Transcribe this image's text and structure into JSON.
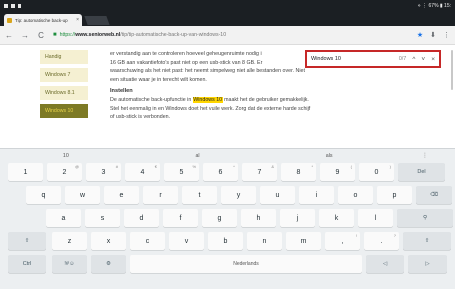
{
  "status": {
    "right_text": "⋄ ⋮ 67% ▮ 15:"
  },
  "tab": {
    "title": "Tip: automatische back-up",
    "close": "×"
  },
  "toolbar": {
    "back": "←",
    "forward": "→",
    "reload": "C",
    "https": "https://",
    "host": "www.seniorweb.nl",
    "path": "/tip/tip-automatische-back-up-van-windows-10",
    "star": "★",
    "download": "⬇",
    "menu": "⋮"
  },
  "findbar": {
    "query": "Windows 10",
    "count": "0/7",
    "up": "^",
    "down": "˅",
    "close": "×"
  },
  "sidebar": {
    "items": [
      {
        "label": "Handig"
      },
      {
        "label": "Windows 7"
      },
      {
        "label": "Windows 8.1"
      },
      {
        "label": "Windows 10"
      }
    ]
  },
  "content": {
    "p1a": "er verstandig aan te controleren hoeveel geheugenruimte nodig i",
    "p1b": "16 GB aan vakantiefoto's past niet op een usb-stick van 8 GB. Er",
    "p1c": "waarschuwing als het niet past: het neemt simpelweg niet alle bestanden over. Niet",
    "p1d": "een situatie waar je in terecht wilt komen.",
    "heading": "Instellen",
    "p2a_pre": "De automatische back-upfunctie in ",
    "p2a_mark": "Windows 10",
    "p2a_post": " maakt het de gebruiker gemakkelijk.",
    "p2b": "Stel het eenmalig in en Windows doet het vuile werk. Zorg dat de externe harde schijf",
    "p2c": "of usb-stick is verbonden."
  },
  "keyboard": {
    "suggestions": [
      "10",
      "al",
      "als"
    ],
    "mic": "⋮",
    "row1": [
      {
        "k": "1"
      },
      {
        "k": "2",
        "s": "@"
      },
      {
        "k": "3",
        "s": "#"
      },
      {
        "k": "4",
        "s": "€"
      },
      {
        "k": "5",
        "s": "%"
      },
      {
        "k": "6",
        "s": "^"
      },
      {
        "k": "7",
        "s": "&"
      },
      {
        "k": "8",
        "s": "*"
      },
      {
        "k": "9",
        "s": "("
      },
      {
        "k": "0",
        "s": ")"
      }
    ],
    "del": "Del",
    "row2": [
      "q",
      "w",
      "e",
      "r",
      "t",
      "y",
      "u",
      "i",
      "o",
      "p"
    ],
    "backspace": "⌫",
    "row3": [
      "a",
      "s",
      "d",
      "f",
      "g",
      "h",
      "j",
      "k",
      "l"
    ],
    "search": "⚲",
    "shift": "⇧",
    "row4": [
      "z",
      "x",
      "c",
      "v",
      "b",
      "n",
      "m",
      ",",
      "."
    ],
    "row4_sup": [
      "",
      "",
      "",
      "",
      "",
      "",
      "",
      "!",
      "?"
    ],
    "ctrl": "Ctrl",
    "sym": "!#☺",
    "settings": "⚙",
    "space": "Nederlands",
    "left": "◁",
    "right": "▷"
  }
}
